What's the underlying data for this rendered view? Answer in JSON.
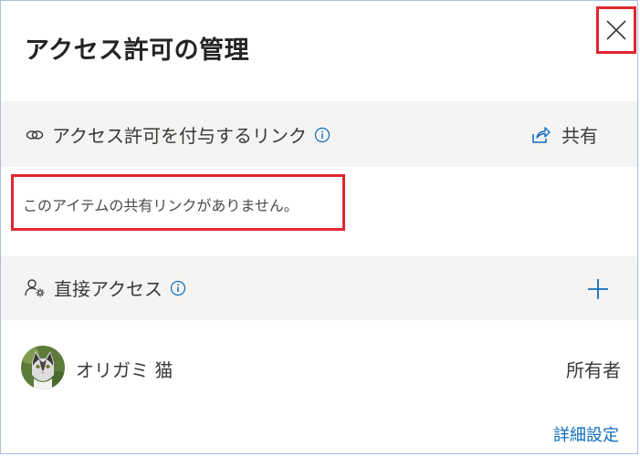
{
  "dialog": {
    "title": "アクセス許可の管理",
    "close_icon": "close-icon"
  },
  "links_section": {
    "icon": "link-icon",
    "title": "アクセス許可を付与するリンク",
    "info_icon": "info-icon",
    "share_icon": "share-icon",
    "share_label": "共有",
    "empty_message": "このアイテムの共有リンクがありません。"
  },
  "direct_section": {
    "icon": "person-settings-icon",
    "title": "直接アクセス",
    "info_icon": "info-icon",
    "add_icon": "plus-icon"
  },
  "people": [
    {
      "name": "オリガミ 猫",
      "role": "所有者",
      "avatar": "cat-photo-avatar"
    }
  ],
  "footer": {
    "advanced_link": "詳細設定"
  },
  "colors": {
    "accent": "#0f6cbd",
    "highlight_border": "#e0262f",
    "section_bg": "#f5f4f2",
    "panel_border": "#a6c0e0"
  }
}
